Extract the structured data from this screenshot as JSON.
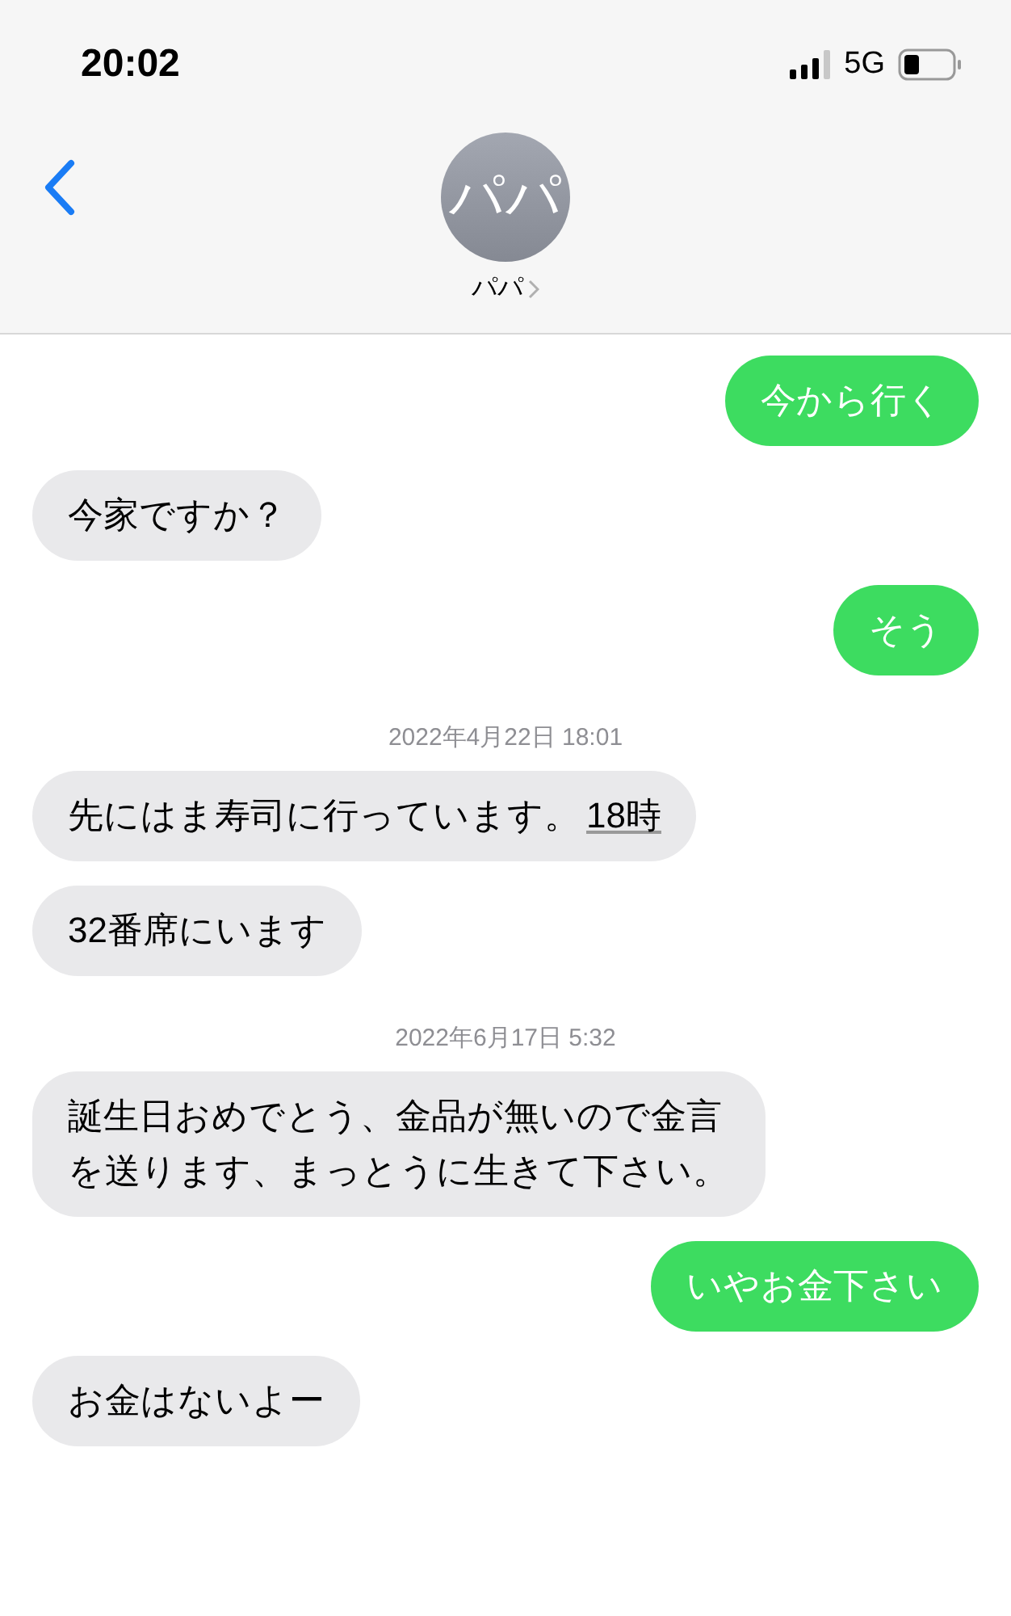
{
  "status_bar": {
    "time": "20:02",
    "network": "5G"
  },
  "header": {
    "avatar_initials": "パパ",
    "contact_name": "パパ"
  },
  "messages": [
    {
      "kind": "sent",
      "text": "今から行く"
    },
    {
      "kind": "received",
      "text": "今家ですか？"
    },
    {
      "kind": "sent",
      "text": "そう"
    },
    {
      "kind": "timestamp",
      "text": "2022年4月22日 18:01"
    },
    {
      "kind": "received",
      "text": "先にはま寿司に行っています。",
      "link": "18時"
    },
    {
      "kind": "received",
      "text": "32番席にいます"
    },
    {
      "kind": "timestamp",
      "text": "2022年6月17日 5:32"
    },
    {
      "kind": "received",
      "text": "誕生日おめでとう、金品が無いので金言を送ります、まっとうに生きて下さい。"
    },
    {
      "kind": "sent",
      "text": "いやお金下さい"
    },
    {
      "kind": "received",
      "text": "お金はないよー"
    }
  ]
}
